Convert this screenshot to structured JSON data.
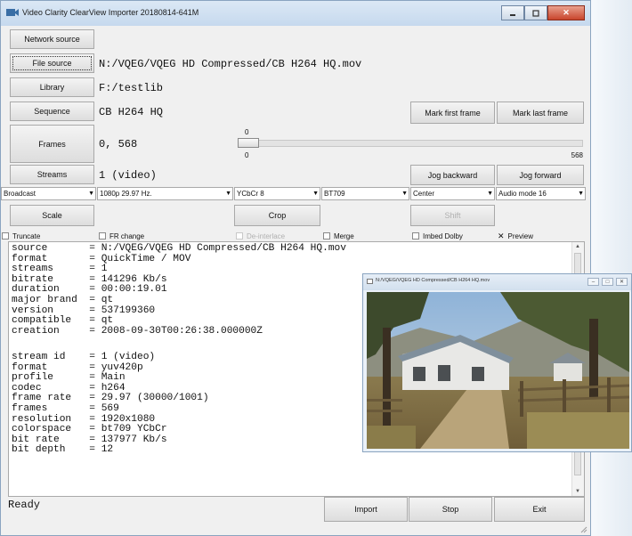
{
  "window": {
    "title": "Video Clarity ClearView Importer 20180814-641M",
    "controls": [
      "minimize",
      "maximize",
      "close"
    ],
    "close_glyph": "✕"
  },
  "buttons": {
    "network_source": "Network source",
    "file_source": "File source",
    "library": "Library",
    "sequence": "Sequence",
    "frames": "Frames",
    "streams": "Streams",
    "mark_first_frame": "Mark first frame",
    "mark_last_frame": "Mark last frame",
    "jog_backward": "Jog backward",
    "jog_forward": "Jog forward",
    "scale": "Scale",
    "crop": "Crop",
    "shift": "Shift",
    "import": "Import",
    "stop": "Stop",
    "exit": "Exit"
  },
  "values": {
    "file_source": "N:/VQEG/VQEG HD Compressed/CB H264 HQ.mov",
    "library": "F:/testlib",
    "sequence": "CB H264 HQ",
    "frames": "0, 568",
    "streams": "1 (video)"
  },
  "slider": {
    "top_value": "0",
    "bottom_min": "0",
    "bottom_max": "568"
  },
  "dropdowns": {
    "broadcast": "Broadcast",
    "format": "1080p 29.97 Hz.",
    "color": "YCbCr 8",
    "matrix": "BT709",
    "position": "Center",
    "audio": "Audio mode 16"
  },
  "checkboxes": {
    "truncate": {
      "label": "Truncate",
      "checked": false
    },
    "fr_change": {
      "label": "FR change",
      "checked": false
    },
    "de_interlace": {
      "label": "De-interlace",
      "checked": false,
      "disabled": true
    },
    "merge": {
      "label": "Merge",
      "checked": false
    },
    "imbed_dolby": {
      "label": "Imbed Dolby",
      "checked": false
    },
    "preview": {
      "label": "Preview",
      "checked": true,
      "mark": "✕"
    }
  },
  "info_lines": [
    "source       = N:/VQEG/VQEG HD Compressed/CB H264 HQ.mov",
    "format       = QuickTime / MOV",
    "streams      = 1",
    "bitrate      = 141296 Kb/s",
    "duration     = 00:00:19.01",
    "major brand  = qt",
    "version      = 537199360",
    "compatible   = qt",
    "creation     = 2008-09-30T00:26:38.000000Z",
    "",
    "stream id    = 1 (video)",
    "format       = yuv420p",
    "profile      = Main",
    "codec        = h264",
    "frame rate   = 29.97 (30000/1001)",
    "frames       = 569",
    "resolution   = 1920x1080",
    "colorspace   = bt709 YCbCr",
    "bit rate     = 137977 Kb/s",
    "bit depth    = 12"
  ],
  "status": "Ready",
  "preview_window": {
    "title": "N:/VQEG/VQEG HD Compressed/CB H264 HQ.mov"
  },
  "icons": {
    "app": "video-camera-icon",
    "dropdown": "chevron-down-icon",
    "scroll_up": "up-arrow-icon",
    "scroll_down": "down-arrow-icon",
    "resize": "resize-grip-icon"
  }
}
